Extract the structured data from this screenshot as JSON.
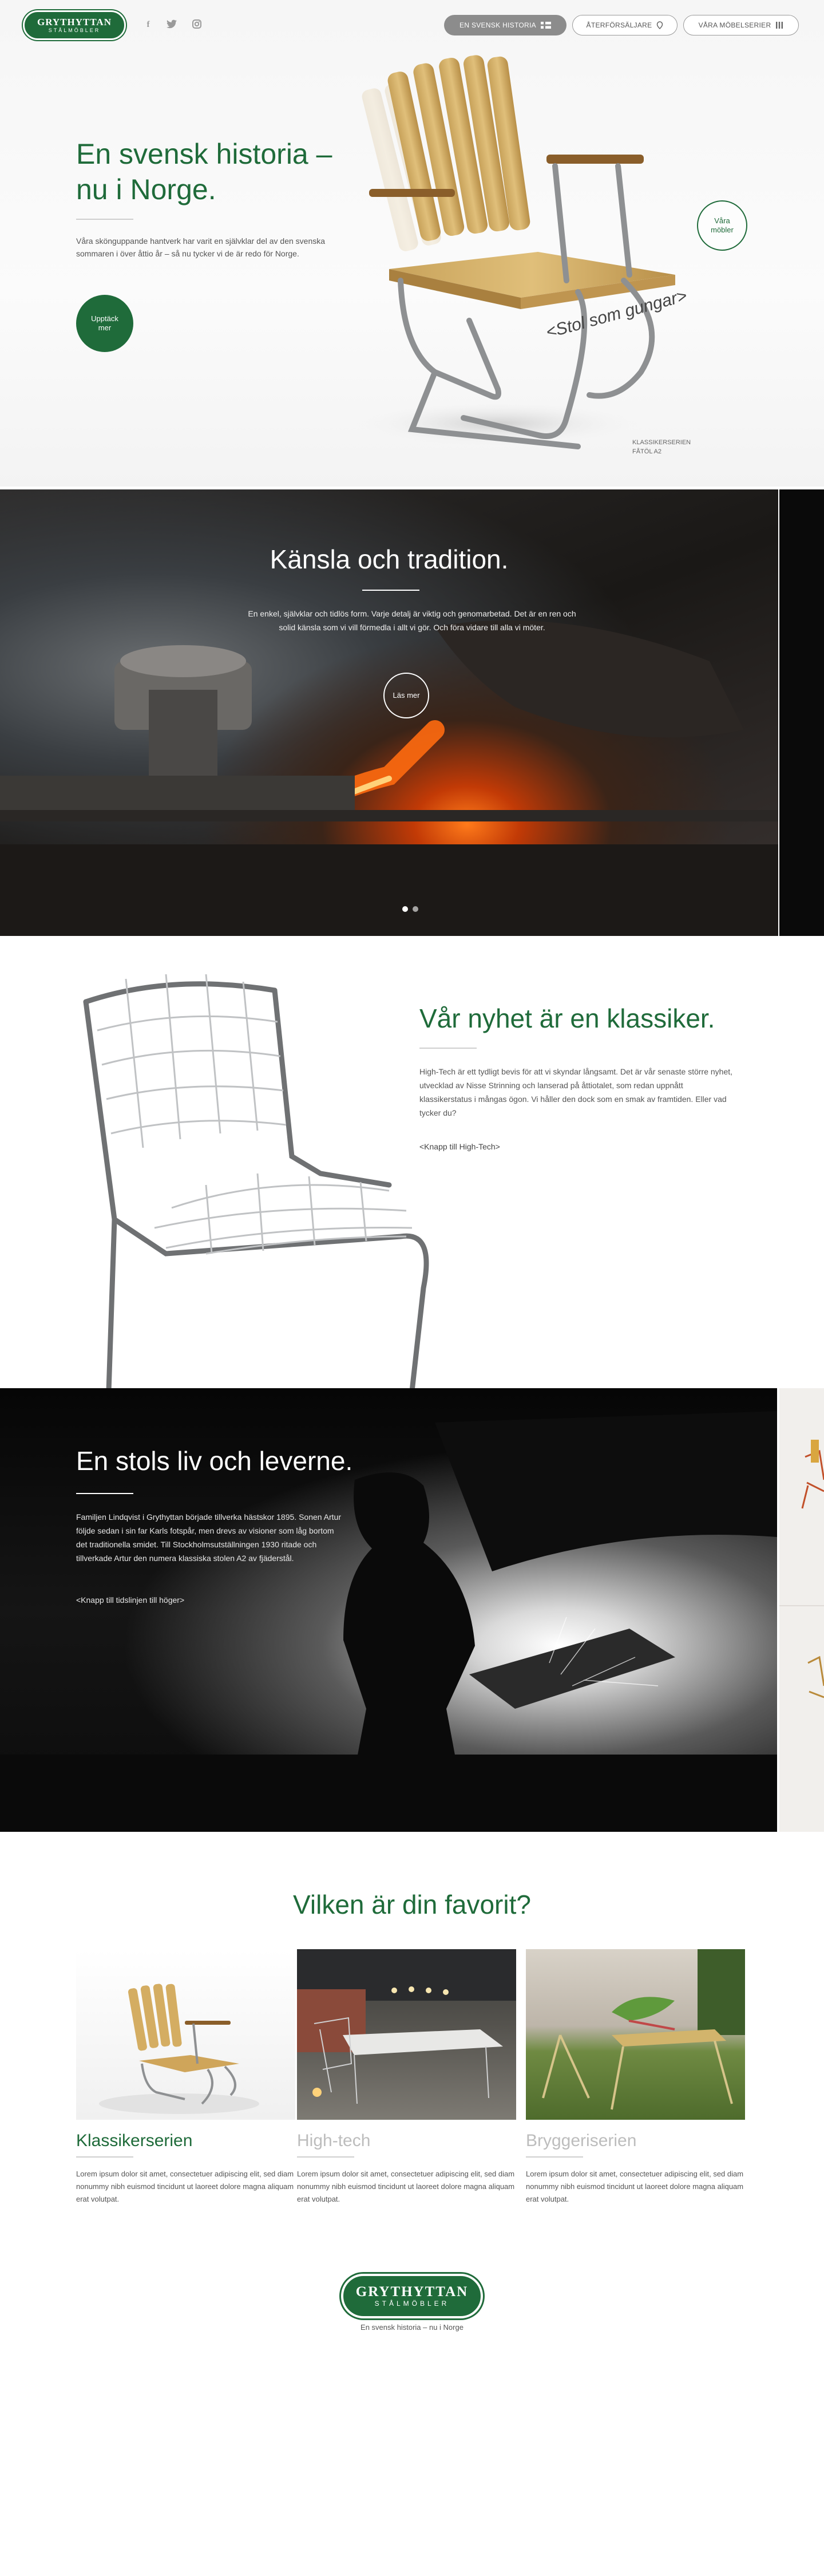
{
  "header": {
    "logo_main": "GRYTHYTTAN",
    "logo_sub": "STÅLMÖBLER",
    "nav": [
      {
        "label": "EN SVENSK HISTORIA"
      },
      {
        "label": "ÅTERFÖRSÄLJARE"
      },
      {
        "label": "VÅRA MÖBELSERIER"
      }
    ],
    "social_icons": [
      "facebook-icon",
      "twitter-icon",
      "instagram-icon"
    ]
  },
  "hero": {
    "title": "En svensk historia – nu i Norge.",
    "text": "Våra skönguppande hantverk har varit en självklar del av den svenska sommaren i över åttio år – så nu tycker vi de är redo för Norge.",
    "cta": "Upptäck mer",
    "side_button": "Våra möbler",
    "tagline": "<Stol som gungar>",
    "caption_line1": "KLASSIKERSERIEN",
    "caption_line2": "FÅtöl A2"
  },
  "tradition": {
    "title": "Känsla och tradition.",
    "text": "En enkel, självklar och tidlös form. Varje detalj är viktig och genomarbetad. Det är en ren och solid känsla som vi vill förmedla i allt vi gör. Och föra vidare till alla vi möter.",
    "button": "Läs mer",
    "slides": 2
  },
  "news": {
    "title": "Vår nyhet är en klassiker.",
    "text": "High-Tech är ett tydligt bevis för att vi skyndar långsamt. Det är vår senaste större nyhet, utvecklad av Nisse Strinning och lanserad på åttiotalet, som redan uppnått klassikerstatus i mångas ögon. Vi håller den dock som en smak av framtiden. Eller vad tycker du?",
    "link": "<Knapp till High-Tech>"
  },
  "history": {
    "title": "En stols liv och leverne.",
    "text": "Familjen Lindqvist i Grythyttan började tillverka hästskor 1895. Sonen Artur följde sedan i sin far Karls fotspår, men drevs av visioner som låg bortom det traditionella smidet. Till Stockholmsutställningen 1930 ritade och tillverkade Artur den numera klassiska stolen A2 av fjäderstål.",
    "link": "<Knapp till tidslinjen till höger>"
  },
  "favorites": {
    "title": "Vilken är din favorit?",
    "cards": [
      {
        "title": "Klassikerserien",
        "text": "Lorem ipsum dolor sit amet, consectetuer adipiscing elit, sed diam nonummy nibh euismod tincidunt ut laoreet dolore magna aliquam erat volutpat.",
        "color": "#1f6b3a"
      },
      {
        "title": "High-tech",
        "text": "Lorem ipsum dolor sit amet, consectetuer adipiscing elit, sed diam nonummy nibh euismod tincidunt ut laoreet dolore magna aliquam erat volutpat.",
        "color": "#bdbdbd"
      },
      {
        "title": "Bryggeriserien",
        "text": "Lorem ipsum dolor sit amet, consectetuer adipiscing elit, sed diam nonummy nibh euismod tincidunt ut laoreet dolore magna aliquam erat volutpat.",
        "color": "#bdbdbd"
      }
    ]
  },
  "footer": {
    "logo_main": "GRYTHYTTAN",
    "logo_sub": "STÅLMÖBLER",
    "tagline": "En svensk historia – nu i Norge"
  },
  "colors": {
    "brand_green": "#1f6b3a"
  }
}
